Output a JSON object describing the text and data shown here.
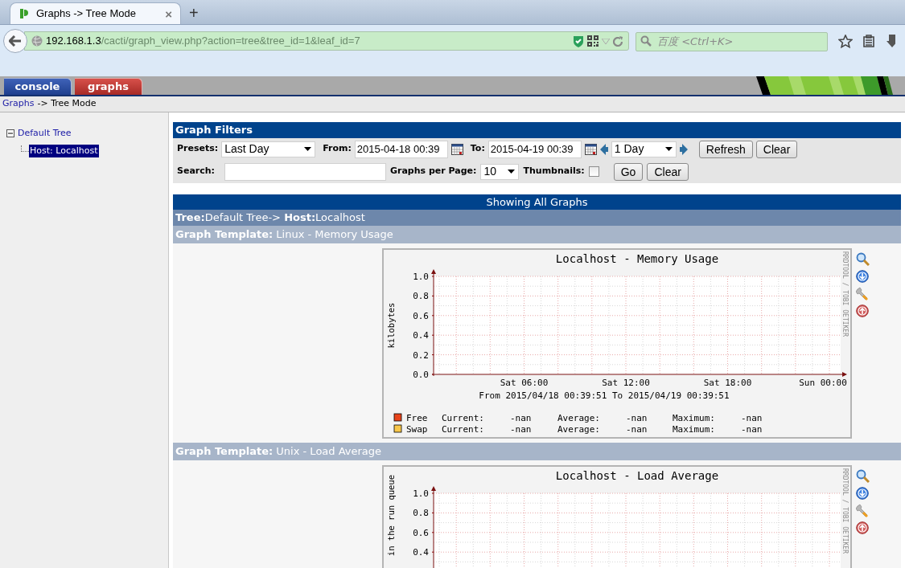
{
  "browser": {
    "tab_title": "Graphs -> Tree Mode",
    "close": "×",
    "new_tab": "+",
    "address_host": "192.168.1.3",
    "address_path": "/cacti/graph_view.php?action=tree&tree_id=1&leaf_id=7",
    "search_placeholder": "百度 <Ctrl+K>"
  },
  "app_tabs": [
    {
      "label": "console",
      "selected": false
    },
    {
      "label": "graphs",
      "selected": true
    }
  ],
  "breadcrumb": {
    "link": "Graphs",
    "rest": "-> Tree Mode"
  },
  "tree": [
    {
      "label": "Default Tree",
      "expanded": true,
      "selected": false,
      "children": [
        {
          "label": "Host: Localhost",
          "selected": true
        }
      ]
    }
  ],
  "filters": {
    "title": "Graph Filters",
    "presets_label": "Presets:",
    "preset": "Last Day",
    "from_label": "From:",
    "from": "2015-04-18 00:39",
    "to_label": "To:",
    "to": "2015-04-19 00:39",
    "timespan": "1 Day",
    "refresh": "Refresh",
    "clear": "Clear",
    "search_label": "Search:",
    "per_page_label": "Graphs per Page:",
    "per_page": "10",
    "thumbnails_label": "Thumbnails:",
    "thumbnails": false,
    "go": "Go",
    "clear_search": "Clear"
  },
  "listing": {
    "title": "Showing All Graphs",
    "tree_path": "**Tree:**Default Tree-> **Host:**Localhost"
  },
  "graphs": [
    {
      "template": "**Graph Template:** Linux - Memory Usage",
      "credit": "RRDTOOL / TOBI OETIKER",
      "range": "From 2015/04/18 00:39:51 To 2015/04/19 00:39:51",
      "chart_data": {
        "type": "line",
        "title": "Localhost - Memory Usage",
        "ylabel": "kilobytes",
        "grid": true,
        "ylim": [
          0,
          1
        ],
        "yticks": [
          {
            "value": 0,
            "label": "0.0"
          },
          {
            "value": 0.2,
            "label": "0.2"
          },
          {
            "value": 0.4,
            "label": "0.4"
          },
          {
            "value": 0.6,
            "label": "0.6"
          },
          {
            "value": 0.8,
            "label": "0.8"
          },
          {
            "value": 1,
            "label": "1.0"
          }
        ],
        "categories": [
          null,
          null,
          null,
          null,
          null,
          "Sat 06:00",
          null,
          null,
          null,
          null,
          null,
          "Sat 12:00",
          null,
          null,
          null,
          null,
          null,
          "Sat 18:00",
          null,
          null,
          null,
          null,
          null,
          "Sun 00:00"
        ]
      },
      "legend": [
        {
          "name": "Free",
          "color": "#e8441b",
          "stats": [
            "Current:",
            "-nan",
            "Average:",
            "-nan",
            "Maximum:",
            "-nan"
          ]
        },
        {
          "name": "Swap",
          "color": "#f9c74a",
          "stats": [
            "Current:",
            "-nan",
            "Average:",
            "-nan",
            "Maximum:",
            "-nan"
          ]
        }
      ]
    },
    {
      "template": "**Graph Template:** Unix - Load Average",
      "credit": "RRDTOOL / TOBI OETIKER",
      "chart_data": {
        "type": "line",
        "title": "Localhost - Load Average",
        "ylabel": "in the run queue",
        "grid": true,
        "ylim": [
          0,
          1
        ],
        "yticks": [
          {
            "value": 0.4,
            "label": "0.4"
          },
          {
            "value": 0.6,
            "label": "0.6"
          },
          {
            "value": 0.8,
            "label": "0.8"
          },
          {
            "value": 1,
            "label": "1.0"
          }
        ],
        "categories": [
          null,
          null,
          null,
          null,
          null,
          null,
          null,
          null,
          null,
          null,
          null,
          null,
          null,
          null,
          null,
          null,
          null,
          null,
          null,
          null,
          null,
          null,
          null,
          null
        ]
      }
    }
  ]
}
